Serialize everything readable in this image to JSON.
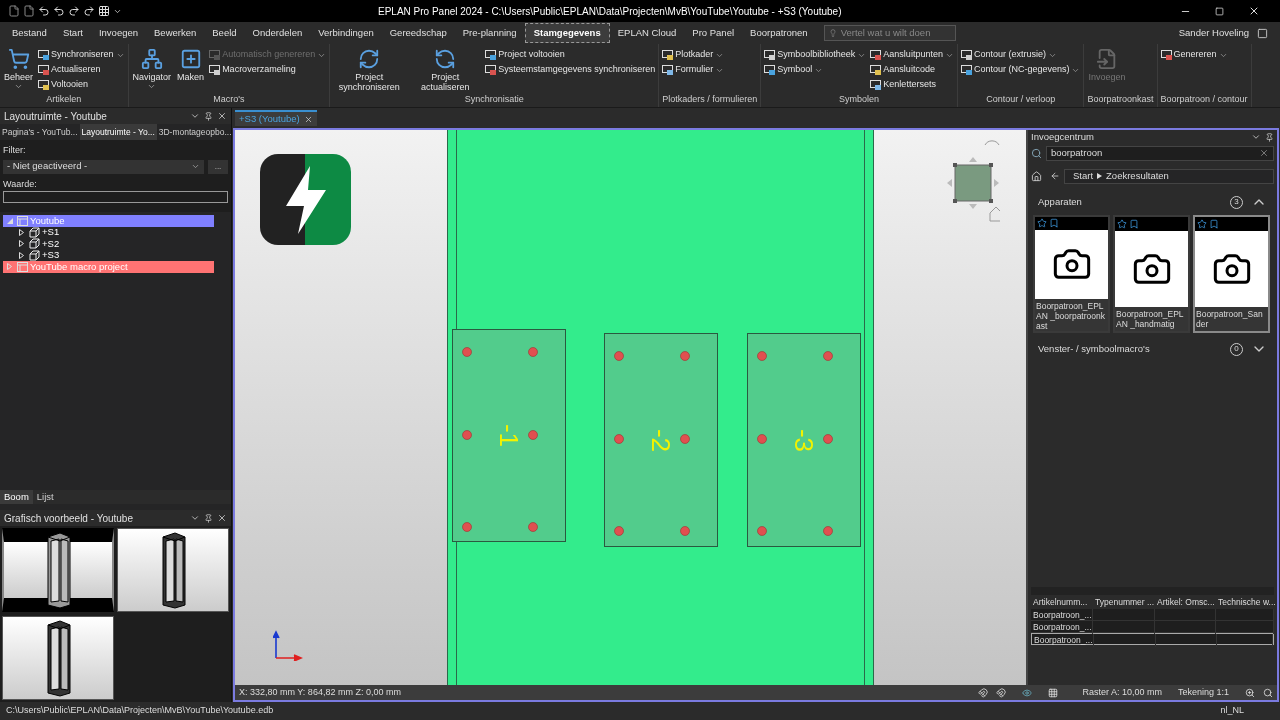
{
  "window": {
    "title": "EPLAN Pro Panel 2024 - C:\\Users\\Public\\EPLAN\\Data\\Projecten\\MvB\\YouTube\\Youtube - +S3 (Youtube)"
  },
  "ribbon_tabs": [
    {
      "label": "Bestand",
      "selected": false
    },
    {
      "label": "Start",
      "selected": false
    },
    {
      "label": "Invoegen",
      "selected": false
    },
    {
      "label": "Bewerken",
      "selected": false
    },
    {
      "label": "Beeld",
      "selected": false
    },
    {
      "label": "Onderdelen",
      "selected": false
    },
    {
      "label": "Verbindingen",
      "selected": false
    },
    {
      "label": "Gereedschap",
      "selected": false
    },
    {
      "label": "Pre-planning",
      "selected": false
    },
    {
      "label": "Stamgegevens",
      "selected": true
    },
    {
      "label": "EPLAN Cloud",
      "selected": false
    },
    {
      "label": "Pro Panel",
      "selected": false
    },
    {
      "label": "Boorpatronen",
      "selected": false
    }
  ],
  "search": {
    "placeholder": "Vertel wat u wilt doen"
  },
  "user": "Sander Hoveling",
  "ribbon_groups": [
    {
      "label": "Artikelen",
      "columns": [
        {
          "kind": "large",
          "items": [
            {
              "label": "Beheer",
              "dropdown": true,
              "disabled": false
            }
          ]
        },
        {
          "kind": "small",
          "items": [
            {
              "label": "Synchroniseren",
              "dropdown": true,
              "disabled": false
            },
            {
              "label": "Actualiseren",
              "dropdown": false,
              "disabled": false
            },
            {
              "label": "Voltooien",
              "dropdown": false,
              "disabled": false
            }
          ]
        }
      ]
    },
    {
      "label": "Macro's",
      "columns": [
        {
          "kind": "large",
          "items": [
            {
              "label": "Navigator",
              "dropdown": true,
              "disabled": false
            }
          ]
        },
        {
          "kind": "large",
          "items": [
            {
              "label": "Maken",
              "dropdown": false,
              "disabled": false
            }
          ]
        },
        {
          "kind": "small",
          "items": [
            {
              "label": "Automatisch genereren",
              "dropdown": true,
              "disabled": true
            },
            {
              "label": "Macroverzameling",
              "dropdown": false,
              "disabled": false
            }
          ]
        }
      ]
    },
    {
      "label": "Synchronisatie",
      "columns": [
        {
          "kind": "large",
          "items": [
            {
              "label": "Project synchroniseren",
              "dropdown": false,
              "disabled": false
            }
          ]
        },
        {
          "kind": "large",
          "items": [
            {
              "label": "Project actualiseren",
              "dropdown": false,
              "disabled": false
            }
          ]
        },
        {
          "kind": "small",
          "items": [
            {
              "label": "Project voltooien",
              "dropdown": false,
              "disabled": false
            },
            {
              "label": "Systeemstamgegevens synchroniseren",
              "dropdown": false,
              "disabled": false
            }
          ]
        }
      ]
    },
    {
      "label": "Plotkaders / formulieren",
      "columns": [
        {
          "kind": "small",
          "items": [
            {
              "label": "Plotkader",
              "dropdown": true,
              "disabled": false
            },
            {
              "label": "Formulier",
              "dropdown": true,
              "disabled": false
            }
          ]
        }
      ]
    },
    {
      "label": "Symbolen",
      "columns": [
        {
          "kind": "small",
          "items": [
            {
              "label": "Symboolbibliotheek",
              "dropdown": true,
              "disabled": false
            },
            {
              "label": "Symbool",
              "dropdown": true,
              "disabled": false
            }
          ]
        },
        {
          "kind": "small",
          "items": [
            {
              "label": "Aansluitpunten",
              "dropdown": true,
              "disabled": false
            },
            {
              "label": "Aansluitcode",
              "dropdown": false,
              "disabled": false
            },
            {
              "label": "Kenlettersets",
              "dropdown": false,
              "disabled": false
            }
          ]
        }
      ]
    },
    {
      "label": "Contour / verloop",
      "columns": [
        {
          "kind": "small",
          "items": [
            {
              "label": "Contour (extrusie)",
              "dropdown": true,
              "disabled": false
            },
            {
              "label": "Contour (NC-gegevens)",
              "dropdown": true,
              "disabled": false
            }
          ]
        }
      ]
    },
    {
      "label": "Boorpatroonkast",
      "columns": [
        {
          "kind": "large",
          "items": [
            {
              "label": "Invoegen",
              "dropdown": false,
              "disabled": true
            }
          ]
        }
      ]
    },
    {
      "label": "Boorpatroon / contour",
      "columns": [
        {
          "kind": "small",
          "items": [
            {
              "label": "Genereren",
              "dropdown": true,
              "disabled": false
            }
          ]
        }
      ]
    }
  ],
  "left_panel": {
    "title": "Layoutruimte - Youtube",
    "tabs": [
      {
        "label": "Pagina's - YouTub...",
        "selected": false
      },
      {
        "label": "Layoutruimte - Yo...",
        "selected": true
      },
      {
        "label": "3D-montageopbo...",
        "selected": false
      }
    ],
    "filter_label": "Filter:",
    "filter_value": "- Niet geactiveerd -",
    "more_button": "...",
    "value_label": "Waarde:",
    "tree": [
      {
        "label": "Youtube",
        "expanded": true,
        "color": "#8080ff",
        "children": [
          {
            "label": "+S1",
            "expanded": false
          },
          {
            "label": "+S2",
            "expanded": false
          },
          {
            "label": "+S3",
            "expanded": false
          }
        ]
      },
      {
        "label": "YouTube macro project",
        "expanded": false,
        "color": "#ff7373"
      }
    ],
    "bottom_tabs": [
      {
        "label": "Boom",
        "selected": true
      },
      {
        "label": "Lijst",
        "selected": false
      }
    ]
  },
  "preview_panel": {
    "title": "Grafisch voorbeeld - Youtube",
    "thumbnails": [
      {
        "selected": true
      },
      {
        "selected": false
      },
      {
        "selected": false
      }
    ]
  },
  "document_tab": {
    "label": "+S3 (Youtube)"
  },
  "canvas": {
    "plates": [
      {
        "label": "-1"
      },
      {
        "label": "-2"
      },
      {
        "label": "-3"
      }
    ],
    "coordinates": "X: 332,80 mm Y: 864,82 mm Z: 0,00 mm",
    "grid": "Raster A: 10,00 mm",
    "scale": "Tekening 1:1"
  },
  "insert_center": {
    "title": "Invoegcentrum",
    "search_value": "boorpatroon",
    "breadcrumb": [
      "Start",
      "Zoekresultaten"
    ],
    "sections": [
      {
        "label": "Apparaten",
        "count": "3",
        "expanded": true,
        "items": [
          {
            "name": "Boorpatroon_EPLAN _boorpatroonkast",
            "selected": false
          },
          {
            "name": "Boorpatroon_EPLAN _handmatig",
            "selected": false
          },
          {
            "name": "Boorpatroon_Sander",
            "selected": true
          }
        ]
      },
      {
        "label": "Venster- / symboolmacro's",
        "count": "0",
        "expanded": false
      }
    ],
    "table": {
      "columns": [
        "Artikelnumm...",
        "Typenummer ...",
        "Artikel: Omsc...",
        "Technische w..."
      ],
      "rows": [
        {
          "cells": [
            "Boorpatroon_...",
            "",
            "",
            ""
          ],
          "selected": false
        },
        {
          "cells": [
            "Boorpatroon_...",
            "",
            "",
            ""
          ],
          "selected": false
        },
        {
          "cells": [
            "Boorpatroon_...",
            "",
            "",
            ""
          ],
          "selected": true
        }
      ]
    }
  },
  "status_bar": {
    "path": "C:\\Users\\Public\\EPLAN\\Data\\Projecten\\MvB\\YouTube\\Youtube.edb",
    "locale": "nl_NL"
  }
}
